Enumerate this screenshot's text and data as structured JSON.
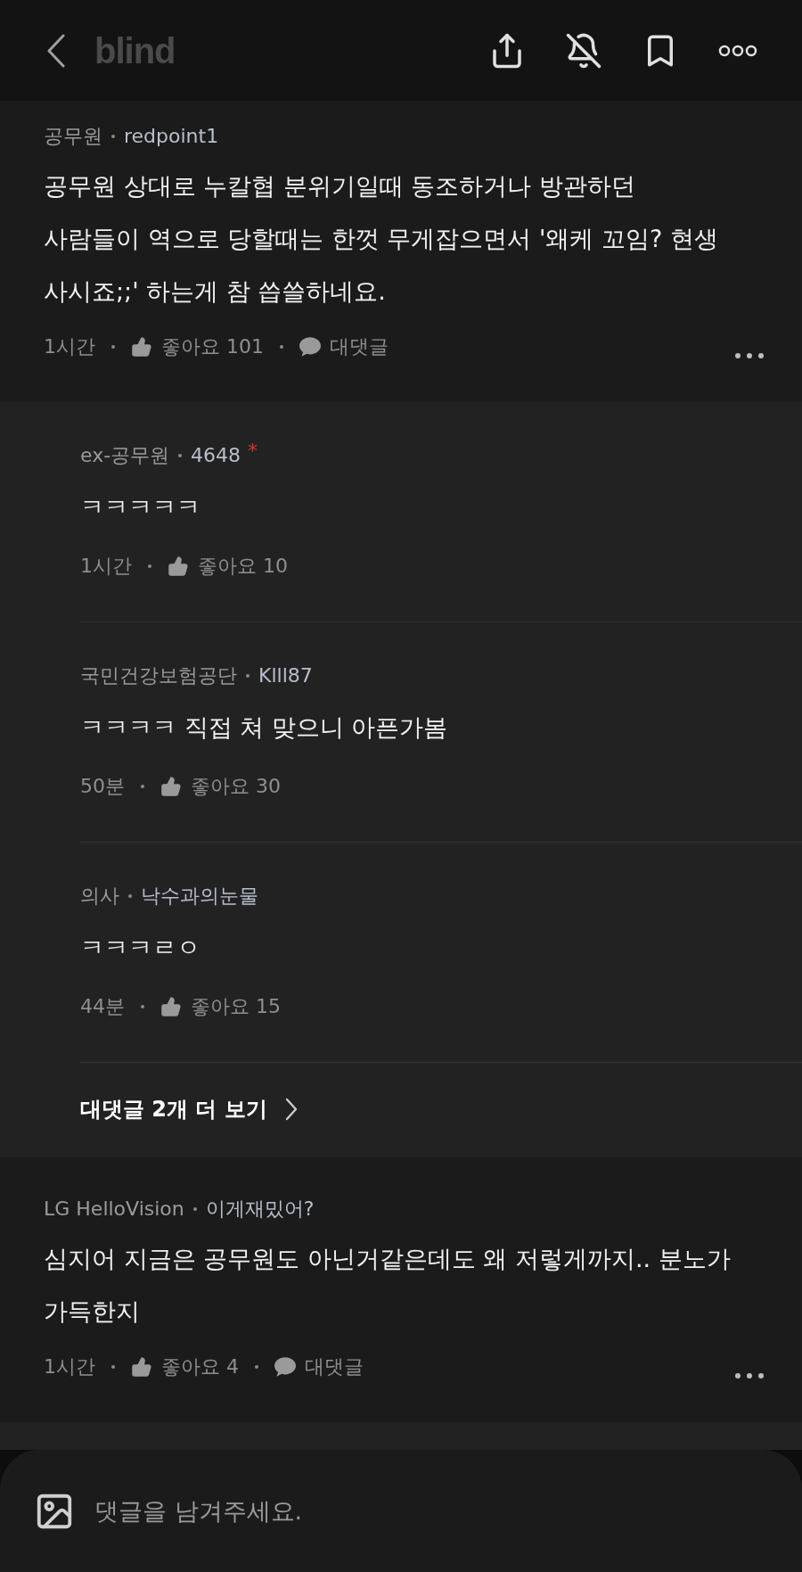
{
  "header": {
    "logo": "blind"
  },
  "comments": [
    {
      "company": "공무원",
      "nickname": "redpoint1",
      "body": "공무원 상대로 누칼협 분위기일때 동조하거나 방관하던 사람들이 역으로 당할때는 한껏 무게잡으면서 '왜케 꼬임? 현생 사시죠;;' 하는게 참 씁쓸하네요.",
      "time": "1시간",
      "likes": "좋아요 101",
      "reply_label": "대댓글",
      "replies": [
        {
          "company": "ex-공무원",
          "nickname": "4648",
          "mark": "*",
          "body": "ㅋㅋㅋㅋㅋ",
          "time": "1시간",
          "likes": "좋아요 10"
        },
        {
          "company": "국민건강보험공단",
          "nickname": "Klll87",
          "body": "ㅋㅋㅋㅋ 직접 쳐 맞으니 아픈가봄",
          "time": "50분",
          "likes": "좋아요 30"
        },
        {
          "company": "의사",
          "nickname": "낙수과의눈물",
          "body": "ㅋㅋㅋㄹㅇ",
          "time": "44분",
          "likes": "좋아요 15"
        }
      ],
      "more_replies": "대댓글 2개 더 보기"
    },
    {
      "company": "LG HelloVision",
      "nickname": "이게재밌어?",
      "body": "심지어 지금은 공무원도 아닌거같은데도 왜 저렇게까지.. 분노가 가득한지",
      "time": "1시간",
      "likes": "좋아요 4",
      "reply_label": "대댓글"
    }
  ],
  "comment_input": {
    "placeholder": "댓글을 남겨주세요."
  }
}
